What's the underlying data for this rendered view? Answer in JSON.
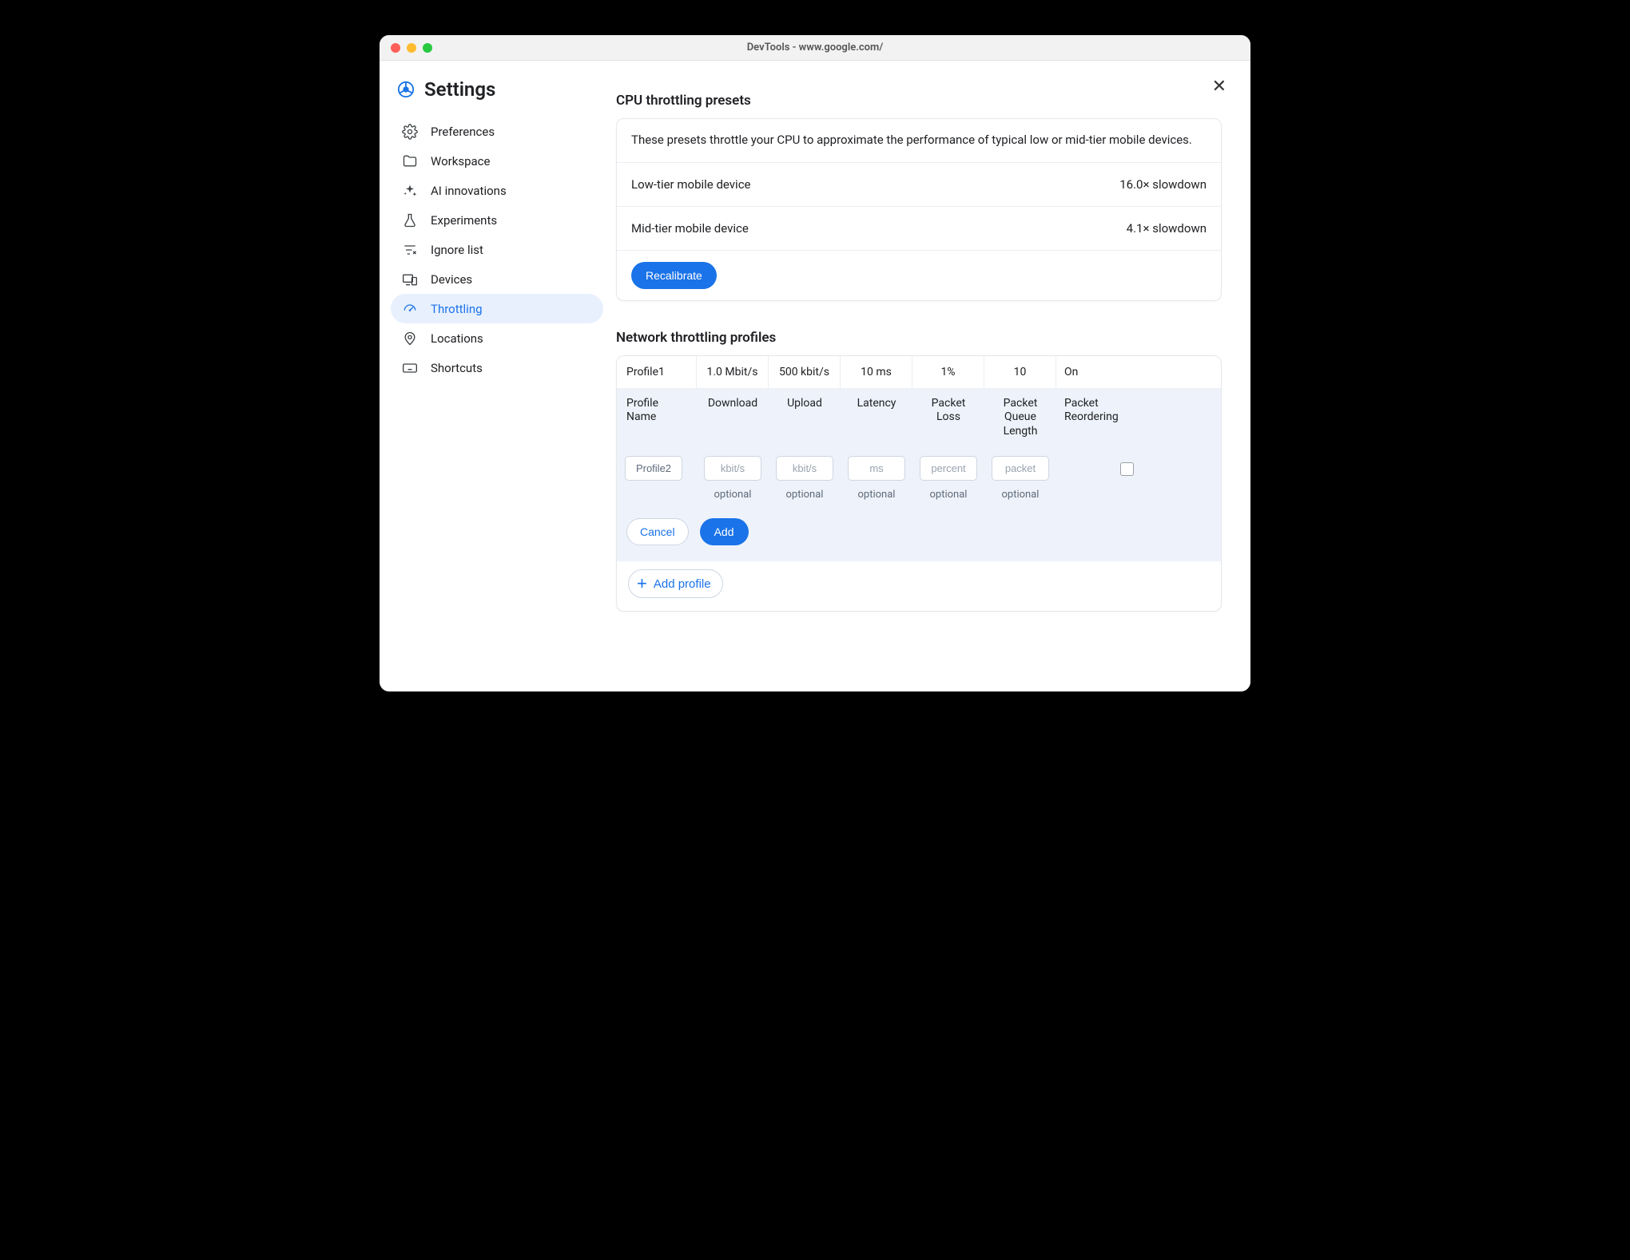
{
  "window": {
    "title": "DevTools - www.google.com/"
  },
  "header": {
    "title": "Settings"
  },
  "sidebar": {
    "items": [
      {
        "icon": "gear-icon",
        "label": "Preferences"
      },
      {
        "icon": "folder-icon",
        "label": "Workspace"
      },
      {
        "icon": "sparkle-icon",
        "label": "AI innovations"
      },
      {
        "icon": "flask-icon",
        "label": "Experiments"
      },
      {
        "icon": "filter-minus-icon",
        "label": "Ignore list"
      },
      {
        "icon": "devices-icon",
        "label": "Devices"
      },
      {
        "icon": "speedometer-icon",
        "label": "Throttling"
      },
      {
        "icon": "pin-icon",
        "label": "Locations"
      },
      {
        "icon": "keyboard-icon",
        "label": "Shortcuts"
      }
    ],
    "active_index": 6
  },
  "cpu_section": {
    "title": "CPU throttling presets",
    "description": "These presets throttle your CPU to approximate the performance of typical low or mid-tier mobile devices.",
    "presets": [
      {
        "name": "Low-tier mobile device",
        "value": "16.0× slowdown"
      },
      {
        "name": "Mid-tier mobile device",
        "value": "4.1× slowdown"
      }
    ],
    "recalibrate_label": "Recalibrate"
  },
  "net_section": {
    "title": "Network throttling profiles",
    "row": {
      "name": "Profile1",
      "download": "1.0 Mbit/s",
      "upload": "500 kbit/s",
      "latency": "10 ms",
      "packet_loss": "1%",
      "queue_length": "10",
      "reordering": "On"
    },
    "edit": {
      "headers": {
        "name": "Profile Name",
        "download": "Download",
        "upload": "Upload",
        "latency": "Latency",
        "packet_loss": "Packet Loss",
        "queue_length": "Packet Queue Length",
        "reordering": "Packet Reordering"
      },
      "inputs": {
        "name_value": "Profile2",
        "download_placeholder": "kbit/s",
        "upload_placeholder": "kbit/s",
        "latency_placeholder": "ms",
        "packet_loss_placeholder": "percent",
        "queue_length_placeholder": "packet"
      },
      "optional_label": "optional",
      "cancel_label": "Cancel",
      "add_label": "Add"
    },
    "add_profile_label": "Add profile"
  }
}
